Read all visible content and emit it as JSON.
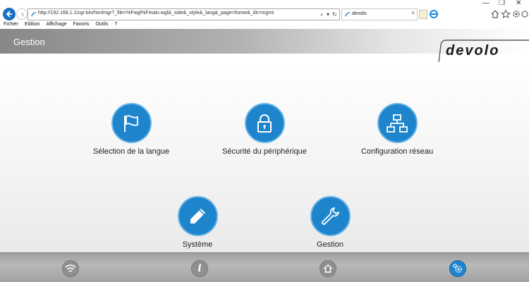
{
  "browser": {
    "address": "http://192.168.1.1/cgi-bin/htmlmgr?_file=%Fwgl%Fmain.wgl&_side&_style&_lang&_page=home&_dir=mgmt",
    "tab_title": "devolo",
    "menu": [
      "Fichier",
      "Edition",
      "Affichage",
      "Favoris",
      "Outils",
      "?"
    ]
  },
  "header": {
    "title": "Gestion",
    "brand": "devolo"
  },
  "tiles": [
    {
      "label": "Sélection de la langue",
      "icon": "flag-icon"
    },
    {
      "label": "Sécurité du périphérique",
      "icon": "lock-icon"
    },
    {
      "label": "Configuration réseau",
      "icon": "network-icon"
    },
    {
      "label": "Système",
      "icon": "pencil-icon"
    },
    {
      "label": "Gestion",
      "icon": "wrench-icon"
    }
  ],
  "bottom_nav": [
    {
      "icon": "wifi-icon"
    },
    {
      "icon": "info-icon"
    },
    {
      "icon": "home-icon"
    },
    {
      "icon": "settings-icon",
      "active": true
    }
  ],
  "colors": {
    "accent": "#1e84cc",
    "header_gradient_start": "#878787",
    "bottom_bar": "#a8a8a8"
  }
}
